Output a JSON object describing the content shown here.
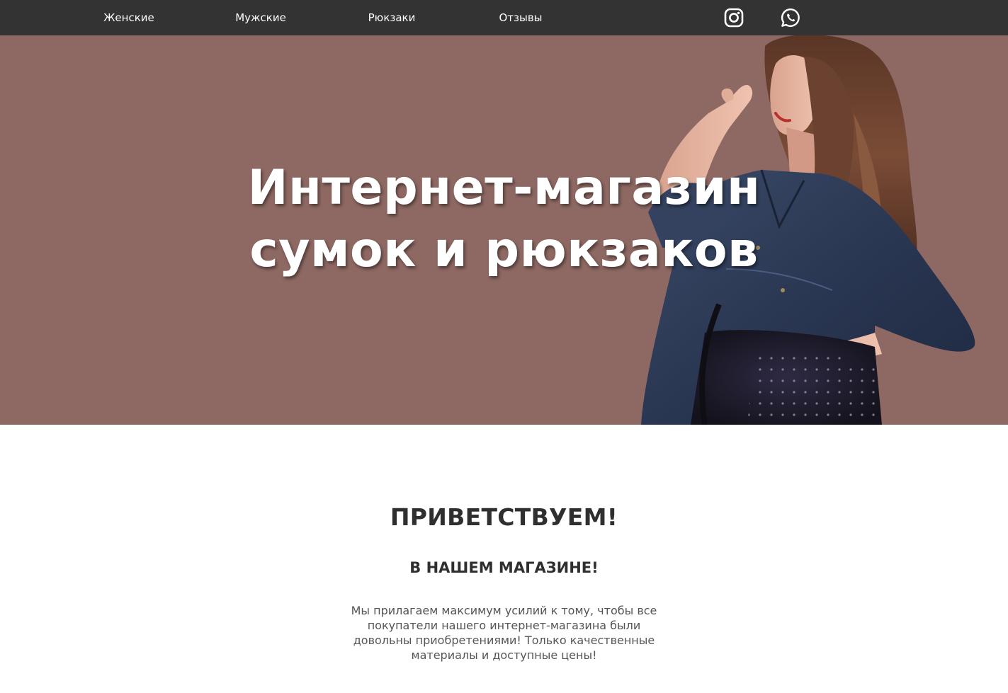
{
  "nav": {
    "links": [
      "Женские",
      "Мужские",
      "Рюкзаки",
      "Отзывы"
    ],
    "social": [
      "instagram-icon",
      "whatsapp-icon"
    ]
  },
  "hero": {
    "title_line1": "Интернет-магазин",
    "title_line2": "сумок и рюкзаков",
    "background": "#8e6862"
  },
  "welcome": {
    "heading": "ПРИВЕТСТВУЕМ!",
    "subheading": "В НАШЕМ МАГАЗИНЕ!",
    "text": "Мы прилагаем максимум усилий к тому, чтобы все покупатели нашего интернет-магазина были довольны приобретениями! Только качественные материалы и доступные цены!"
  },
  "colors": {
    "nav_bg": "#333333",
    "hero_bg": "#8e6862",
    "heading": "#2f2f2f",
    "body_text": "#555555"
  }
}
